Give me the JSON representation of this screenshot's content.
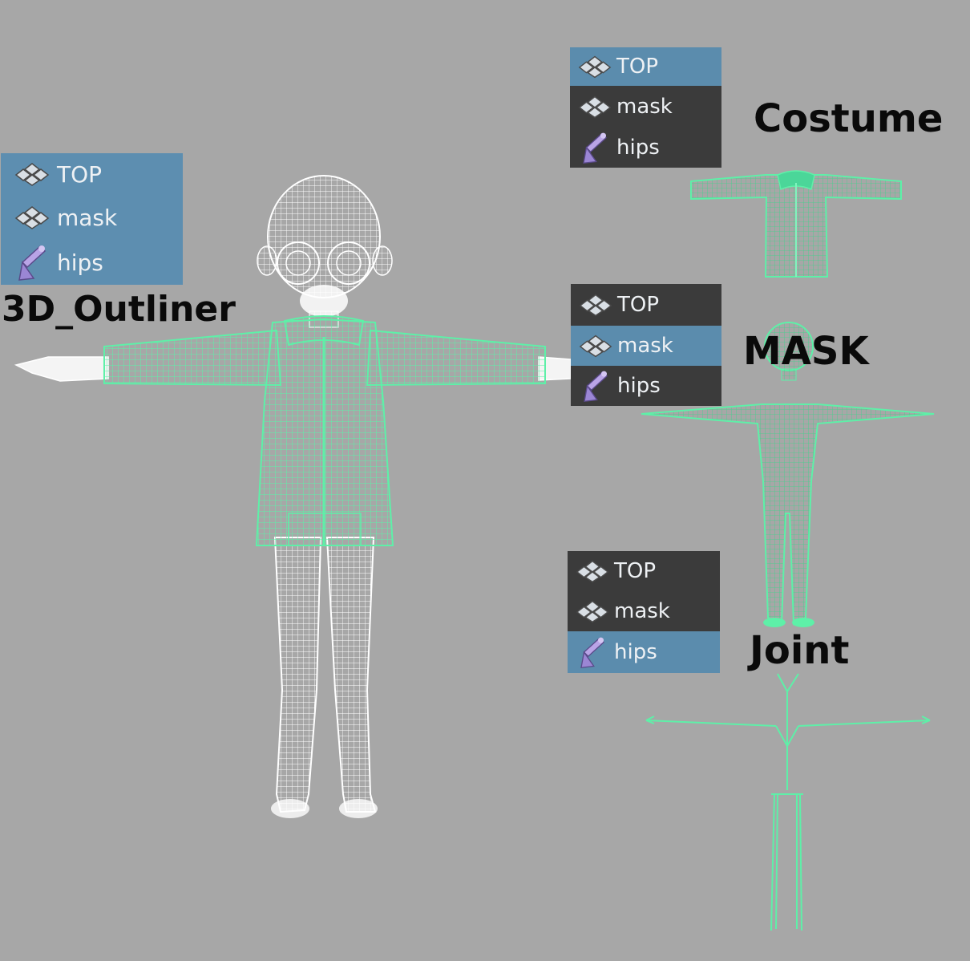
{
  "captions": {
    "outliner3d": "3D_Outliner",
    "costume": "Costume",
    "mask": "MASK",
    "joint": "Joint"
  },
  "outliners": {
    "main": {
      "items": [
        {
          "label": "TOP",
          "icon": "group-node-icon"
        },
        {
          "label": "mask",
          "icon": "group-node-icon"
        },
        {
          "label": "hips",
          "icon": "joint-icon"
        }
      ],
      "selected": "all"
    },
    "costume": {
      "items": [
        {
          "label": "TOP",
          "icon": "group-node-icon"
        },
        {
          "label": "mask",
          "icon": "group-node-icon"
        },
        {
          "label": "hips",
          "icon": "joint-icon"
        }
      ],
      "selected": "TOP"
    },
    "mask": {
      "items": [
        {
          "label": "TOP",
          "icon": "group-node-icon"
        },
        {
          "label": "mask",
          "icon": "group-node-icon"
        },
        {
          "label": "hips",
          "icon": "joint-icon"
        }
      ],
      "selected": "mask"
    },
    "joint": {
      "items": [
        {
          "label": "TOP",
          "icon": "group-node-icon"
        },
        {
          "label": "mask",
          "icon": "group-node-icon"
        },
        {
          "label": "hips",
          "icon": "joint-icon"
        }
      ],
      "selected": "hips"
    }
  },
  "colors": {
    "background": "#a7a7a7",
    "wireframe": "#ffffff",
    "highlight_wire": "#5ef0a8",
    "panel_dark": "#3b3b3b",
    "panel_selected": "#5b8cad",
    "joint_icon": "#b9a4e6"
  }
}
